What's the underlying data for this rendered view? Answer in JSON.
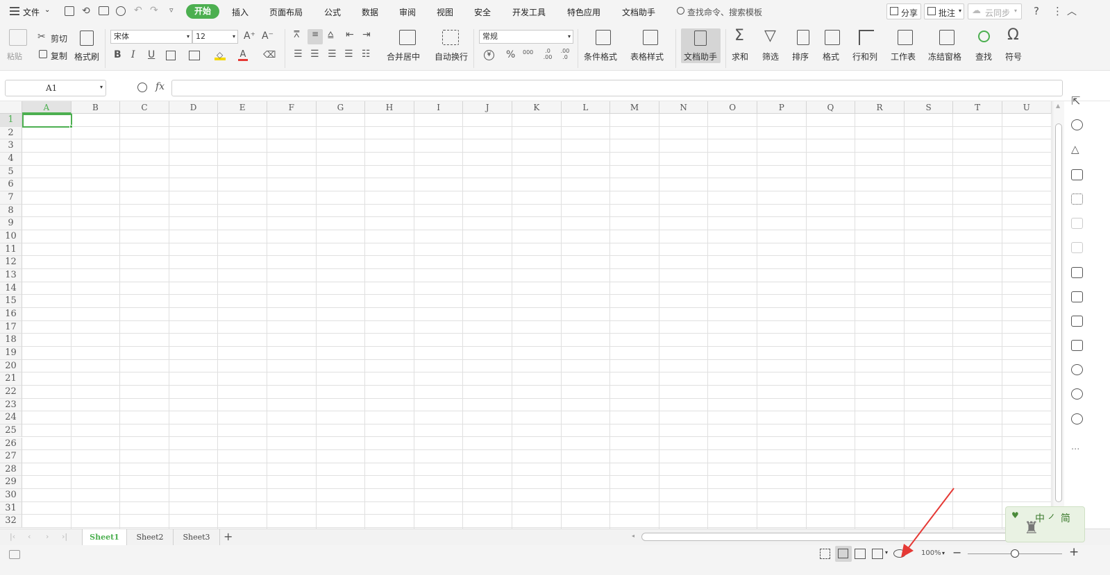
{
  "menubar": {
    "file": "文件",
    "tabs": [
      "开始",
      "插入",
      "页面布局",
      "公式",
      "数据",
      "审阅",
      "视图",
      "安全",
      "开发工具",
      "特色应用",
      "文档助手"
    ],
    "search": "查找命令、搜索模板",
    "share": "分享",
    "comment": "批注",
    "cloud": "云同步"
  },
  "ribbon": {
    "paste": "粘贴",
    "cut": "剪切",
    "copy": "复制",
    "format_painter": "格式刷",
    "font_name": "宋体",
    "font_size": "12",
    "bold": "B",
    "italic": "I",
    "underline": "U",
    "merge_center": "合并居中",
    "wrap_text": "自动换行",
    "number_format": "常规",
    "cond_format": "条件格式",
    "table_style": "表格样式",
    "doc_assistant": "文档助手",
    "sum": "求和",
    "filter": "筛选",
    "sort": "排序",
    "format": "格式",
    "row_col": "行和列",
    "worksheet": "工作表",
    "freeze": "冻结窗格",
    "find": "查找",
    "symbol": "符号",
    "pct": "%",
    "thousands": "000",
    "inc_dec": ".0 .00",
    "dec_dec": ".00 .0"
  },
  "formula_bar": {
    "cell_ref": "A1",
    "fx": "fx",
    "value": ""
  },
  "grid": {
    "columns": [
      "A",
      "B",
      "C",
      "D",
      "E",
      "F",
      "G",
      "H",
      "I",
      "J",
      "K",
      "L",
      "M",
      "N",
      "O",
      "P",
      "Q",
      "R",
      "S",
      "T",
      "U"
    ],
    "rows": [
      "1",
      "2",
      "3",
      "4",
      "5",
      "6",
      "7",
      "8",
      "9",
      "10",
      "11",
      "12",
      "13",
      "14",
      "15",
      "16",
      "17",
      "18",
      "19",
      "20",
      "21",
      "22",
      "23",
      "24",
      "25",
      "26",
      "27",
      "28",
      "29",
      "30",
      "31",
      "32"
    ],
    "selected_cell": "A1"
  },
  "sheets": {
    "tabs": [
      "Sheet1",
      "Sheet2",
      "Sheet3"
    ],
    "active": "Sheet1",
    "add": "+"
  },
  "status": {
    "zoom": "100%",
    "zoom_out": "−",
    "zoom_in": "+"
  },
  "watermark": {
    "text": "中 ㇒ 简"
  },
  "colors": {
    "accent": "#4caf50",
    "annotation_arrow": "#e53935"
  }
}
